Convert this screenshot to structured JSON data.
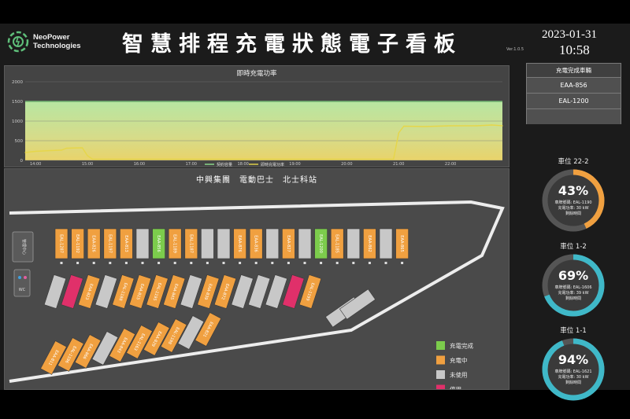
{
  "header": {
    "logo_line1": "NeoPower",
    "logo_line2": "Technologies",
    "title": "智慧排程充電狀態電子看板",
    "version": "Ver.1.0.5",
    "date": "2023-01-31",
    "time": "10:58"
  },
  "chart": {
    "title": "即時充電功率",
    "legend": [
      "契約容量",
      "即時充電功率"
    ]
  },
  "chart_data": {
    "type": "area",
    "title": "即時充電功率",
    "x_ticks": [
      "14:00",
      "15:00",
      "16:00",
      "17:00",
      "18:00",
      "19:00",
      "20:00",
      "21:00",
      "22:00"
    ],
    "y_ticks": [
      0,
      500,
      1000,
      1500,
      2000
    ],
    "ylim": [
      0,
      2000
    ],
    "series": [
      {
        "name": "契約容量",
        "color": "#8fe08f",
        "x": [
          13.8,
          23.0
        ],
        "y": [
          1500,
          1500
        ]
      },
      {
        "name": "即時充電功率",
        "color": "#e6d64a",
        "x": [
          13.8,
          14.0,
          14.3,
          14.5,
          14.6,
          14.9,
          15.0,
          15.1,
          15.4,
          16.0,
          17.0,
          18.0,
          19.0,
          20.0,
          20.9,
          21.0,
          21.1,
          21.5,
          22.0,
          22.5,
          22.8,
          23.0
        ],
        "y": [
          200,
          230,
          250,
          260,
          310,
          320,
          120,
          30,
          30,
          30,
          30,
          30,
          30,
          30,
          30,
          700,
          870,
          860,
          880,
          880,
          900,
          880
        ]
      }
    ]
  },
  "map": {
    "title": "中興集團　電動巴士　北士科站",
    "restroom_label": "WC",
    "office_label": "管理中心",
    "legend": [
      {
        "label": "充電完成",
        "color": "#7ccc4c"
      },
      {
        "label": "充電中",
        "color": "#f0a040"
      },
      {
        "label": "未使用",
        "color": "#c8c8c8"
      },
      {
        "label": "停用",
        "color": "#e0306a"
      }
    ],
    "top_row": [
      {
        "status": "charging",
        "bus": "EAL-1287"
      },
      {
        "status": "charging",
        "bus": "EAL-1192"
      },
      {
        "status": "charging",
        "bus": "EAA-826"
      },
      {
        "status": "charging",
        "bus": "EAL-1197"
      },
      {
        "status": "charging",
        "bus": "EAA-813"
      },
      {
        "status": "unused",
        "bus": ""
      },
      {
        "status": "done",
        "bus": "EAA-856"
      },
      {
        "status": "charging",
        "bus": "EAL-1189"
      },
      {
        "status": "charging",
        "bus": "EAL-1187"
      },
      {
        "status": "unused",
        "bus": ""
      },
      {
        "status": "unused",
        "bus": ""
      },
      {
        "status": "charging",
        "bus": "EAA-876"
      },
      {
        "status": "charging",
        "bus": "EAA-836"
      },
      {
        "status": "unused",
        "bus": ""
      },
      {
        "status": "charging",
        "bus": "EAA-827"
      },
      {
        "status": "unused",
        "bus": ""
      },
      {
        "status": "done",
        "bus": "EAL-1200"
      },
      {
        "status": "charging",
        "bus": "EAL-1185"
      },
      {
        "status": "unused",
        "bus": ""
      },
      {
        "status": "charging",
        "bus": "EAA-862"
      },
      {
        "status": "unused",
        "bus": ""
      },
      {
        "status": "charging",
        "bus": "EAA-865"
      }
    ],
    "mid_row": [
      {
        "status": "unused",
        "bus": ""
      },
      {
        "status": "disabled",
        "bus": ""
      },
      {
        "status": "charging",
        "bus": "EAA-823"
      },
      {
        "status": "unused",
        "bus": ""
      },
      {
        "status": "charging",
        "bus": "EAL-1188"
      },
      {
        "status": "charging",
        "bus": "EAA-815"
      },
      {
        "status": "charging",
        "bus": "EAL-1195"
      },
      {
        "status": "charging",
        "bus": "EAA-845"
      },
      {
        "status": "unused",
        "bus": ""
      },
      {
        "status": "charging",
        "bus": "EAA-839"
      },
      {
        "status": "charging",
        "bus": "EAA-872"
      },
      {
        "status": "unused",
        "bus": ""
      },
      {
        "status": "unused",
        "bus": ""
      },
      {
        "status": "unused",
        "bus": ""
      },
      {
        "status": "disabled",
        "bus": ""
      },
      {
        "status": "charging",
        "bus": "EAL-1199"
      }
    ],
    "bottom_row": [
      {
        "status": "charging",
        "bus": "EAA-811"
      },
      {
        "status": "charging",
        "bus": "EAL-1196"
      },
      {
        "status": "charging",
        "bus": "EAA-866"
      },
      {
        "status": "unused",
        "bus": ""
      },
      {
        "status": "charging",
        "bus": "EAA-843"
      },
      {
        "status": "charging",
        "bus": "EAL-1163"
      },
      {
        "status": "charging",
        "bus": "EAA-829"
      },
      {
        "status": "charging",
        "bus": "EAL-1198"
      },
      {
        "status": "unused",
        "bus": ""
      },
      {
        "status": "charging",
        "bus": "EAA-821"
      }
    ]
  },
  "sidebar": {
    "complete_header": "充電完成車輛",
    "complete_list": [
      "EAA-856",
      "EAL-1200",
      ""
    ],
    "gauges": [
      {
        "label": "車位 22-2",
        "percent": 43,
        "pct_text": "43%",
        "line1": "車牌號碼: EAL-1190",
        "line2": "充電功率: 30 kW",
        "line3": "剩餘時間",
        "color": "#f0a040"
      },
      {
        "label": "車位 1-2",
        "percent": 69,
        "pct_text": "69%",
        "line1": "車牌號碼: EAL-1606",
        "line2": "充電功率: 39 kW",
        "line3": "剩餘時間",
        "color": "#3fb8c8"
      },
      {
        "label": "車位 1-1",
        "percent": 94,
        "pct_text": "94%",
        "line1": "車牌號碼: EAL-1621",
        "line2": "充電功率: 30 kW",
        "line3": "剩餘時間",
        "color": "#3fb8c8"
      }
    ]
  }
}
